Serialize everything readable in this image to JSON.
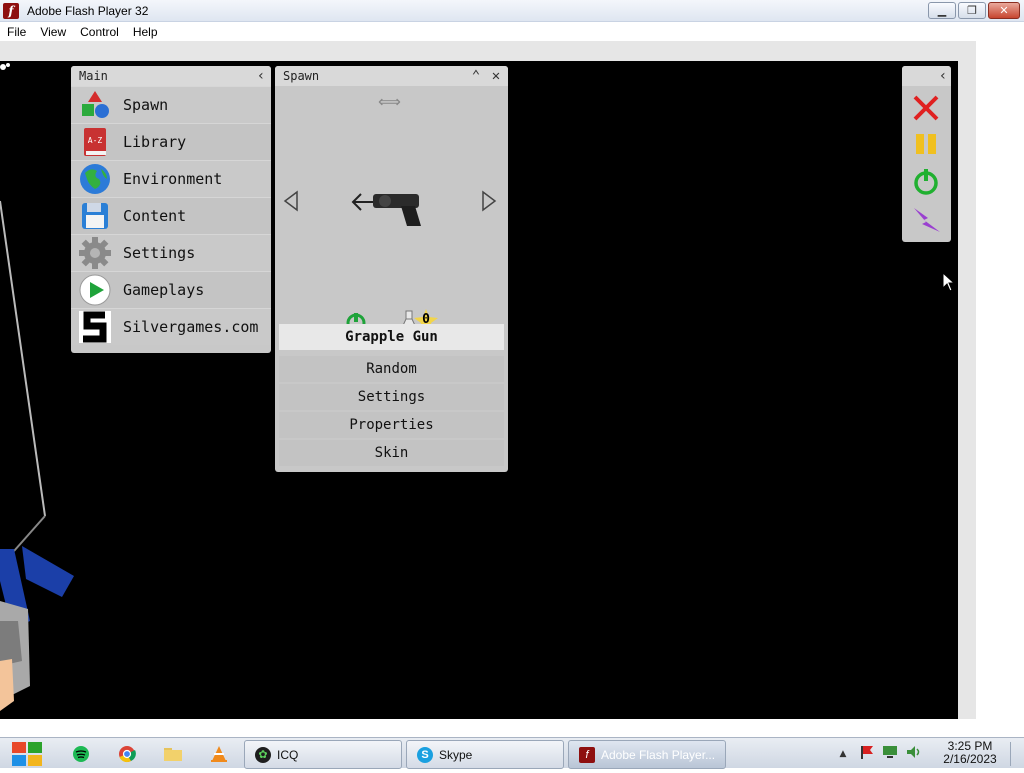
{
  "window": {
    "title": "Adobe Flash Player 32",
    "app_icon": "flash-icon",
    "buttons": [
      "minimize",
      "restore",
      "close"
    ]
  },
  "menubar": {
    "items": [
      "File",
      "View",
      "Control",
      "Help"
    ]
  },
  "main_panel": {
    "title": "Main",
    "items": [
      {
        "label": "Spawn",
        "icon": "spawn-shapes-icon"
      },
      {
        "label": "Library",
        "icon": "library-book-icon"
      },
      {
        "label": "Environment",
        "icon": "globe-icon"
      },
      {
        "label": "Content",
        "icon": "floppy-disk-icon"
      },
      {
        "label": "Settings",
        "icon": "gear-icon"
      },
      {
        "label": "Gameplays",
        "icon": "play-icon"
      },
      {
        "label": "Silvergames.com",
        "icon": "silvergames-logo-icon"
      }
    ]
  },
  "spawn_panel": {
    "title": "Spawn",
    "item_icon": "grapple-gun-icon",
    "counter": "0",
    "selected_item": "Grapple Gun",
    "buttons": [
      "Random",
      "Settings",
      "Properties",
      "Skin"
    ]
  },
  "tools_panel": {
    "icons": [
      "close-red-x-icon",
      "pause-icon",
      "power-icon",
      "lightning-icon"
    ]
  },
  "taskbar": {
    "tasks": [
      {
        "label": "ICQ",
        "icon": "icq-icon"
      },
      {
        "label": "Skype",
        "icon": "skype-icon"
      },
      {
        "label": "Adobe Flash Player...",
        "icon": "flash-icon"
      }
    ],
    "clock": {
      "time": "3:25 PM",
      "date": "2/16/2023"
    }
  },
  "colors": {
    "stage": "#000000",
    "panel": "#c8c8c8",
    "selected_button": "#e8e8e8",
    "tool_red": "#e02020",
    "tool_yellow": "#f0c020",
    "tool_green": "#20b030",
    "tool_purple": "#9a40d0"
  }
}
